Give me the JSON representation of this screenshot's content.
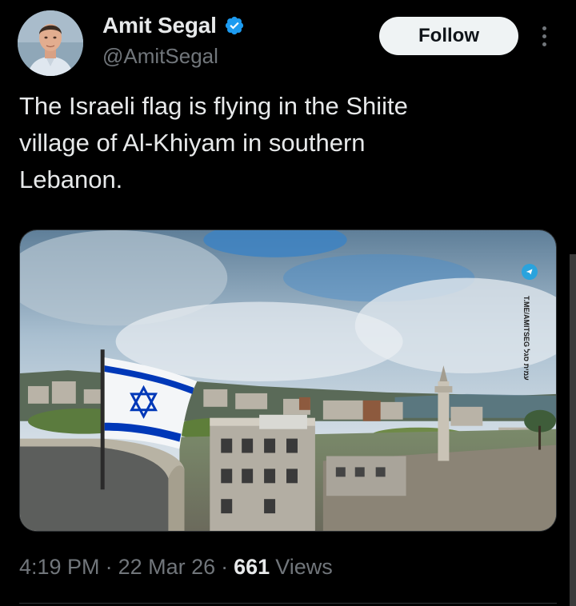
{
  "author": {
    "display_name": "Amit Segal",
    "handle": "@AmitSegal",
    "verified": true
  },
  "follow_button": {
    "label": "Follow"
  },
  "tweet": {
    "text": "The Israeli flag is flying in the Shiite\nvillage of Al-Khiyam in southern\nLebanon."
  },
  "media": {
    "watermark": "T.ME/AMITSEG עמית סגל"
  },
  "meta": {
    "time": "4:19 PM",
    "separator": "·",
    "date": "22 Mar 26",
    "views_count": "661",
    "views_label": "Views"
  },
  "colors": {
    "background": "#000000",
    "text_primary": "#e7e9ea",
    "text_secondary": "#71767b",
    "verified_blue": "#1d9bf0",
    "follow_bg": "#eff3f4",
    "flag_blue": "#0038b8"
  },
  "icons": {
    "verified": "verified-badge-icon",
    "more": "more-vertical-icon",
    "telegram": "telegram-icon"
  }
}
